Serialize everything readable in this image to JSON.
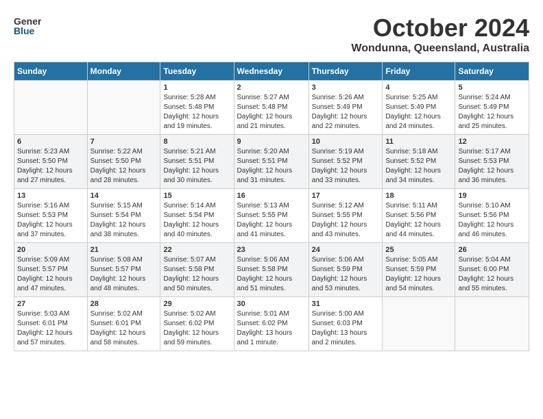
{
  "header": {
    "logo_general": "General",
    "logo_blue": "Blue",
    "month_title": "October 2024",
    "location": "Wondunna, Queensland, Australia"
  },
  "calendar": {
    "days_of_week": [
      "Sunday",
      "Monday",
      "Tuesday",
      "Wednesday",
      "Thursday",
      "Friday",
      "Saturday"
    ],
    "weeks": [
      [
        {
          "day": "",
          "info": ""
        },
        {
          "day": "",
          "info": ""
        },
        {
          "day": "1",
          "info": "Sunrise: 5:28 AM\nSunset: 5:48 PM\nDaylight: 12 hours and 19 minutes."
        },
        {
          "day": "2",
          "info": "Sunrise: 5:27 AM\nSunset: 5:48 PM\nDaylight: 12 hours and 21 minutes."
        },
        {
          "day": "3",
          "info": "Sunrise: 5:26 AM\nSunset: 5:49 PM\nDaylight: 12 hours and 22 minutes."
        },
        {
          "day": "4",
          "info": "Sunrise: 5:25 AM\nSunset: 5:49 PM\nDaylight: 12 hours and 24 minutes."
        },
        {
          "day": "5",
          "info": "Sunrise: 5:24 AM\nSunset: 5:49 PM\nDaylight: 12 hours and 25 minutes."
        }
      ],
      [
        {
          "day": "6",
          "info": "Sunrise: 5:23 AM\nSunset: 5:50 PM\nDaylight: 12 hours and 27 minutes."
        },
        {
          "day": "7",
          "info": "Sunrise: 5:22 AM\nSunset: 5:50 PM\nDaylight: 12 hours and 28 minutes."
        },
        {
          "day": "8",
          "info": "Sunrise: 5:21 AM\nSunset: 5:51 PM\nDaylight: 12 hours and 30 minutes."
        },
        {
          "day": "9",
          "info": "Sunrise: 5:20 AM\nSunset: 5:51 PM\nDaylight: 12 hours and 31 minutes."
        },
        {
          "day": "10",
          "info": "Sunrise: 5:19 AM\nSunset: 5:52 PM\nDaylight: 12 hours and 33 minutes."
        },
        {
          "day": "11",
          "info": "Sunrise: 5:18 AM\nSunset: 5:52 PM\nDaylight: 12 hours and 34 minutes."
        },
        {
          "day": "12",
          "info": "Sunrise: 5:17 AM\nSunset: 5:53 PM\nDaylight: 12 hours and 36 minutes."
        }
      ],
      [
        {
          "day": "13",
          "info": "Sunrise: 5:16 AM\nSunset: 5:53 PM\nDaylight: 12 hours and 37 minutes."
        },
        {
          "day": "14",
          "info": "Sunrise: 5:15 AM\nSunset: 5:54 PM\nDaylight: 12 hours and 38 minutes."
        },
        {
          "day": "15",
          "info": "Sunrise: 5:14 AM\nSunset: 5:54 PM\nDaylight: 12 hours and 40 minutes."
        },
        {
          "day": "16",
          "info": "Sunrise: 5:13 AM\nSunset: 5:55 PM\nDaylight: 12 hours and 41 minutes."
        },
        {
          "day": "17",
          "info": "Sunrise: 5:12 AM\nSunset: 5:55 PM\nDaylight: 12 hours and 43 minutes."
        },
        {
          "day": "18",
          "info": "Sunrise: 5:11 AM\nSunset: 5:56 PM\nDaylight: 12 hours and 44 minutes."
        },
        {
          "day": "19",
          "info": "Sunrise: 5:10 AM\nSunset: 5:56 PM\nDaylight: 12 hours and 46 minutes."
        }
      ],
      [
        {
          "day": "20",
          "info": "Sunrise: 5:09 AM\nSunset: 5:57 PM\nDaylight: 12 hours and 47 minutes."
        },
        {
          "day": "21",
          "info": "Sunrise: 5:08 AM\nSunset: 5:57 PM\nDaylight: 12 hours and 48 minutes."
        },
        {
          "day": "22",
          "info": "Sunrise: 5:07 AM\nSunset: 5:58 PM\nDaylight: 12 hours and 50 minutes."
        },
        {
          "day": "23",
          "info": "Sunrise: 5:06 AM\nSunset: 5:58 PM\nDaylight: 12 hours and 51 minutes."
        },
        {
          "day": "24",
          "info": "Sunrise: 5:06 AM\nSunset: 5:59 PM\nDaylight: 12 hours and 53 minutes."
        },
        {
          "day": "25",
          "info": "Sunrise: 5:05 AM\nSunset: 5:59 PM\nDaylight: 12 hours and 54 minutes."
        },
        {
          "day": "26",
          "info": "Sunrise: 5:04 AM\nSunset: 6:00 PM\nDaylight: 12 hours and 55 minutes."
        }
      ],
      [
        {
          "day": "27",
          "info": "Sunrise: 5:03 AM\nSunset: 6:01 PM\nDaylight: 12 hours and 57 minutes."
        },
        {
          "day": "28",
          "info": "Sunrise: 5:02 AM\nSunset: 6:01 PM\nDaylight: 12 hours and 58 minutes."
        },
        {
          "day": "29",
          "info": "Sunrise: 5:02 AM\nSunset: 6:02 PM\nDaylight: 12 hours and 59 minutes."
        },
        {
          "day": "30",
          "info": "Sunrise: 5:01 AM\nSunset: 6:02 PM\nDaylight: 13 hours and 1 minute."
        },
        {
          "day": "31",
          "info": "Sunrise: 5:00 AM\nSunset: 6:03 PM\nDaylight: 13 hours and 2 minutes."
        },
        {
          "day": "",
          "info": ""
        },
        {
          "day": "",
          "info": ""
        }
      ]
    ]
  }
}
